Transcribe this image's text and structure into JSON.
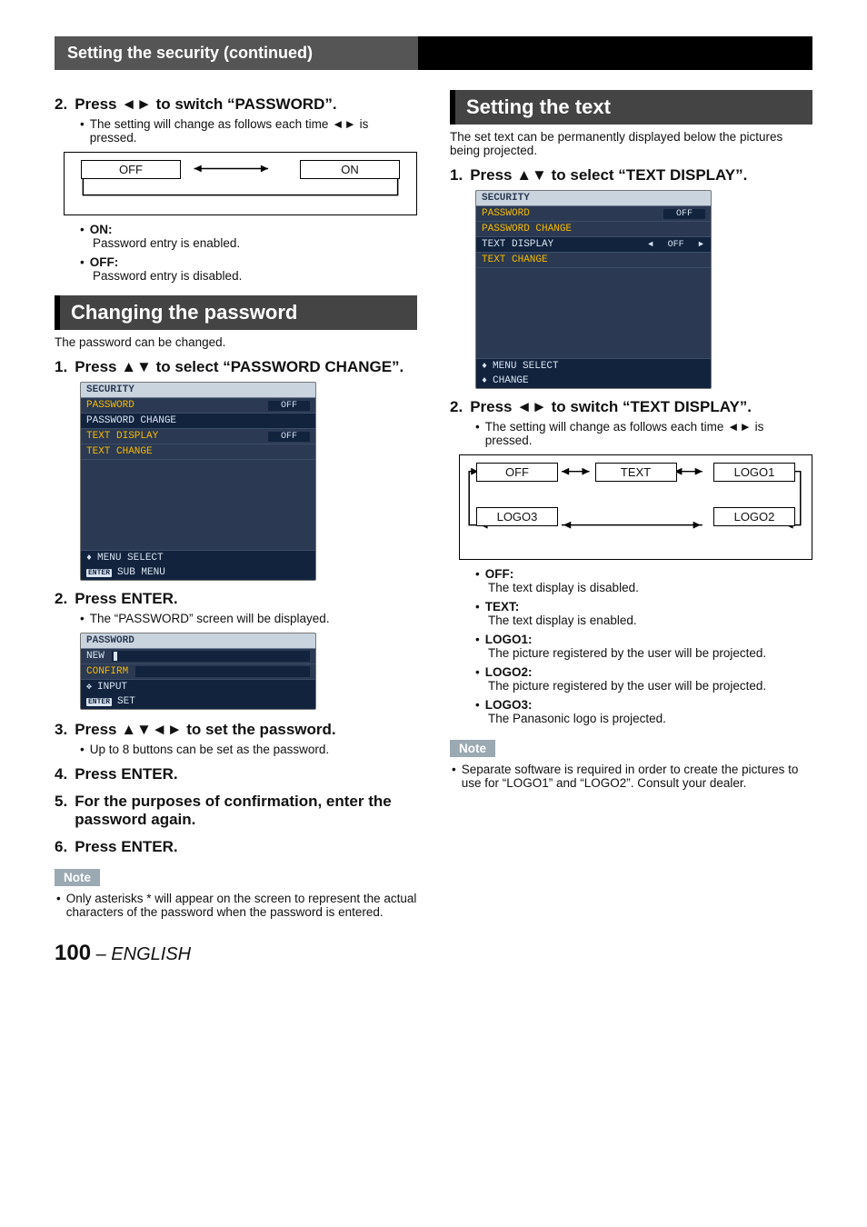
{
  "header": {
    "title": "Setting the security (continued)"
  },
  "left": {
    "step2": {
      "num": "2.",
      "title_a": "Press ",
      "title_b": " to switch “PASSWORD”.",
      "bullet": "The setting will change as follows each time ◄► is pressed."
    },
    "flow1": {
      "off": "OFF",
      "on": "ON"
    },
    "opts1": {
      "on_label": "ON:",
      "on_desc": "Password entry is enabled.",
      "off_label": "OFF:",
      "off_desc": "Password entry is disabled."
    },
    "section_changepw": "Changing the password",
    "changepw_intro": "The password can be changed.",
    "cp_step1": {
      "num": "1.",
      "title_a": "Press ",
      "title_b": " to select “PASSWORD CHANGE”."
    },
    "osd1": {
      "title": "SECURITY",
      "r1_label": "PASSWORD",
      "r1_val": "OFF",
      "r2_label": "PASSWORD CHANGE",
      "r3_label": "TEXT DISPLAY",
      "r3_val": "OFF",
      "r4_label": "TEXT CHANGE",
      "f1": "MENU SELECT",
      "f2_key": "ENTER",
      "f2": "SUB MENU"
    },
    "cp_step2": {
      "num": "2.",
      "title": "Press ENTER.",
      "bullet": "The “PASSWORD” screen will be displayed."
    },
    "osd2": {
      "title": "PASSWORD",
      "r1": "NEW",
      "r2": "CONFIRM",
      "f1": "INPUT",
      "f2_key": "ENTER",
      "f2": "SET"
    },
    "cp_step3": {
      "num": "3.",
      "title_a": "Press ",
      "title_b": " to set the password.",
      "bullet": "Up to 8 buttons can be set as the password."
    },
    "cp_step4": {
      "num": "4.",
      "title": "Press ENTER."
    },
    "cp_step5": {
      "num": "5.",
      "title": "For the purposes of confirmation, enter the password again."
    },
    "cp_step6": {
      "num": "6.",
      "title": "Press ENTER."
    },
    "note_label": "Note",
    "note_body": "Only asterisks * will appear on the screen to represent the actual characters of the password when the password is entered."
  },
  "right": {
    "section_text": "Setting the text",
    "text_intro": "The set text can be permanently displayed below the pictures being projected.",
    "t_step1": {
      "num": "1.",
      "title_a": "Press ",
      "title_b": " to select “TEXT DISPLAY”."
    },
    "osd3": {
      "title": "SECURITY",
      "r1_label": "PASSWORD",
      "r1_val": "OFF",
      "r2_label": "PASSWORD CHANGE",
      "r3_label": "TEXT DISPLAY",
      "r3_val": "OFF",
      "r4_label": "TEXT CHANGE",
      "f1": "MENU SELECT",
      "f2": "CHANGE"
    },
    "t_step2": {
      "num": "2.",
      "title_a": "Press ",
      "title_b": " to switch “TEXT DISPLAY”.",
      "bullet": "The setting will change as follows each time ◄► is pressed."
    },
    "flow2": {
      "off": "OFF",
      "text": "TEXT",
      "logo1": "LOGO1",
      "logo2": "LOGO2",
      "logo3": "LOGO3"
    },
    "opts2": {
      "off_label": "OFF:",
      "off_desc": "The text display is disabled.",
      "text_label": "TEXT:",
      "text_desc": "The text display is enabled.",
      "logo1_label": "LOGO1:",
      "logo1_desc": "The picture registered by the user will be projected.",
      "logo2_label": "LOGO2:",
      "logo2_desc": "The picture registered by the user will be projected.",
      "logo3_label": "LOGO3:",
      "logo3_desc": "The Panasonic logo is projected."
    },
    "note_label": "Note",
    "note_body": "Separate software is required in order to create the pictures to use for “LOGO1” and “LOGO2”. Consult your dealer."
  },
  "footer": {
    "page": "100",
    "dash": " – ",
    "lang": "ENGLISH"
  }
}
